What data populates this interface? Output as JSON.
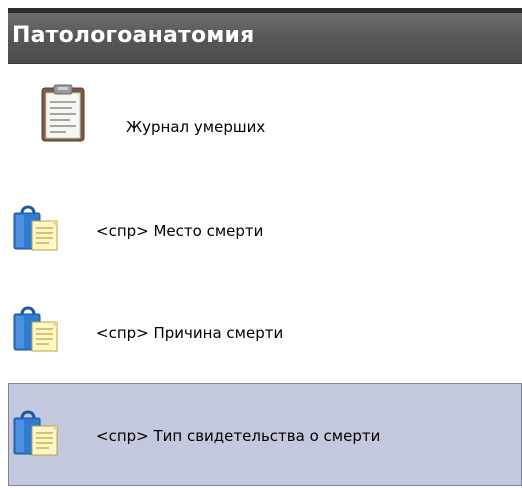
{
  "panel": {
    "title": "Патологоанатомия",
    "items": [
      {
        "label": "Журнал умерших",
        "icon": "clipboard-icon",
        "selected": false
      },
      {
        "label": "<спр> Место смерти",
        "icon": "reference-book-icon",
        "selected": false
      },
      {
        "label": "<спр> Причина смерти",
        "icon": "reference-book-icon",
        "selected": false
      },
      {
        "label": "<спр> Тип свидетельства о смерти",
        "icon": "reference-book-icon",
        "selected": true
      }
    ]
  },
  "colors": {
    "header_bg": "#585858",
    "header_text": "#ffffff",
    "selection_bg": "#c4c8de",
    "selection_border": "#7d8198"
  }
}
